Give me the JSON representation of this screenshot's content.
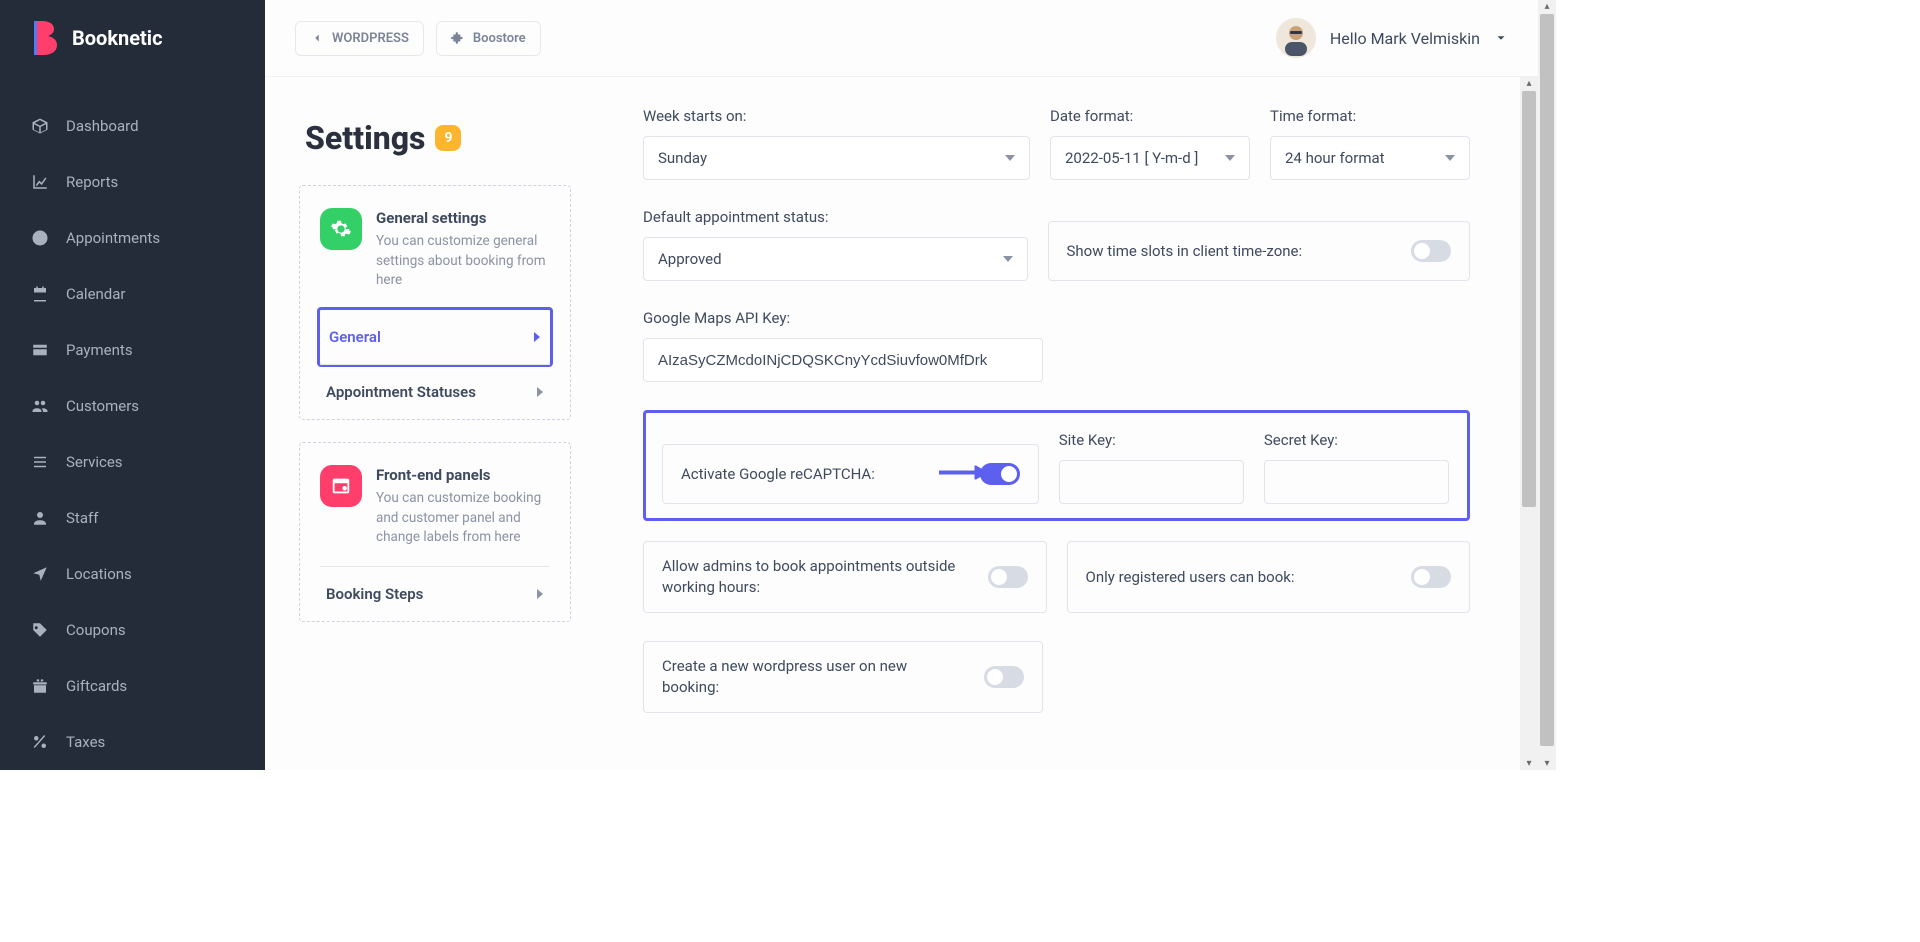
{
  "brand": "Booknetic",
  "nav": {
    "dashboard": "Dashboard",
    "reports": "Reports",
    "appointments": "Appointments",
    "calendar": "Calendar",
    "payments": "Payments",
    "customers": "Customers",
    "services": "Services",
    "staff": "Staff",
    "locations": "Locations",
    "coupons": "Coupons",
    "giftcards": "Giftcards",
    "taxes": "Taxes"
  },
  "breadcrumbs": {
    "wordpress": "WORDPRESS",
    "boostore": "Boostore"
  },
  "user_greeting": "Hello Mark Velmiskin",
  "settings": {
    "title": "Settings",
    "badge": "9",
    "cards": {
      "general": {
        "title": "General settings",
        "desc": "You can customize general settings about booking from here"
      },
      "general_tab": "General",
      "appt_statuses_tab": "Appointment Statuses",
      "frontend": {
        "title": "Front-end panels",
        "desc": "You can customize booking and customer panel and change labels from here"
      },
      "booking_steps_tab": "Booking Steps"
    }
  },
  "form": {
    "week_starts_label": "Week starts on:",
    "week_starts_value": "Sunday",
    "date_format_label": "Date format:",
    "date_format_value": "2022-05-11 [ Y-m-d ]",
    "time_format_label": "Time format:",
    "time_format_value": "24 hour format",
    "default_status_label": "Default appointment status:",
    "default_status_value": "Approved",
    "timezone_toggle_label": "Show time slots in client time-zone:",
    "maps_key_label": "Google Maps API Key:",
    "maps_key_value": "AIzaSyCZMcdoINjCDQSKCnyYcdSiuvfow0MfDrk",
    "site_key_label": "Site Key:",
    "secret_key_label": "Secret Key:",
    "recaptcha_label": "Activate Google reCAPTCHA:",
    "outside_hours_label": "Allow admins to book appointments outside working hours:",
    "registered_only_label": "Only registered users can book:",
    "create_wp_user_label": "Create a new wordpress user on new booking:"
  }
}
